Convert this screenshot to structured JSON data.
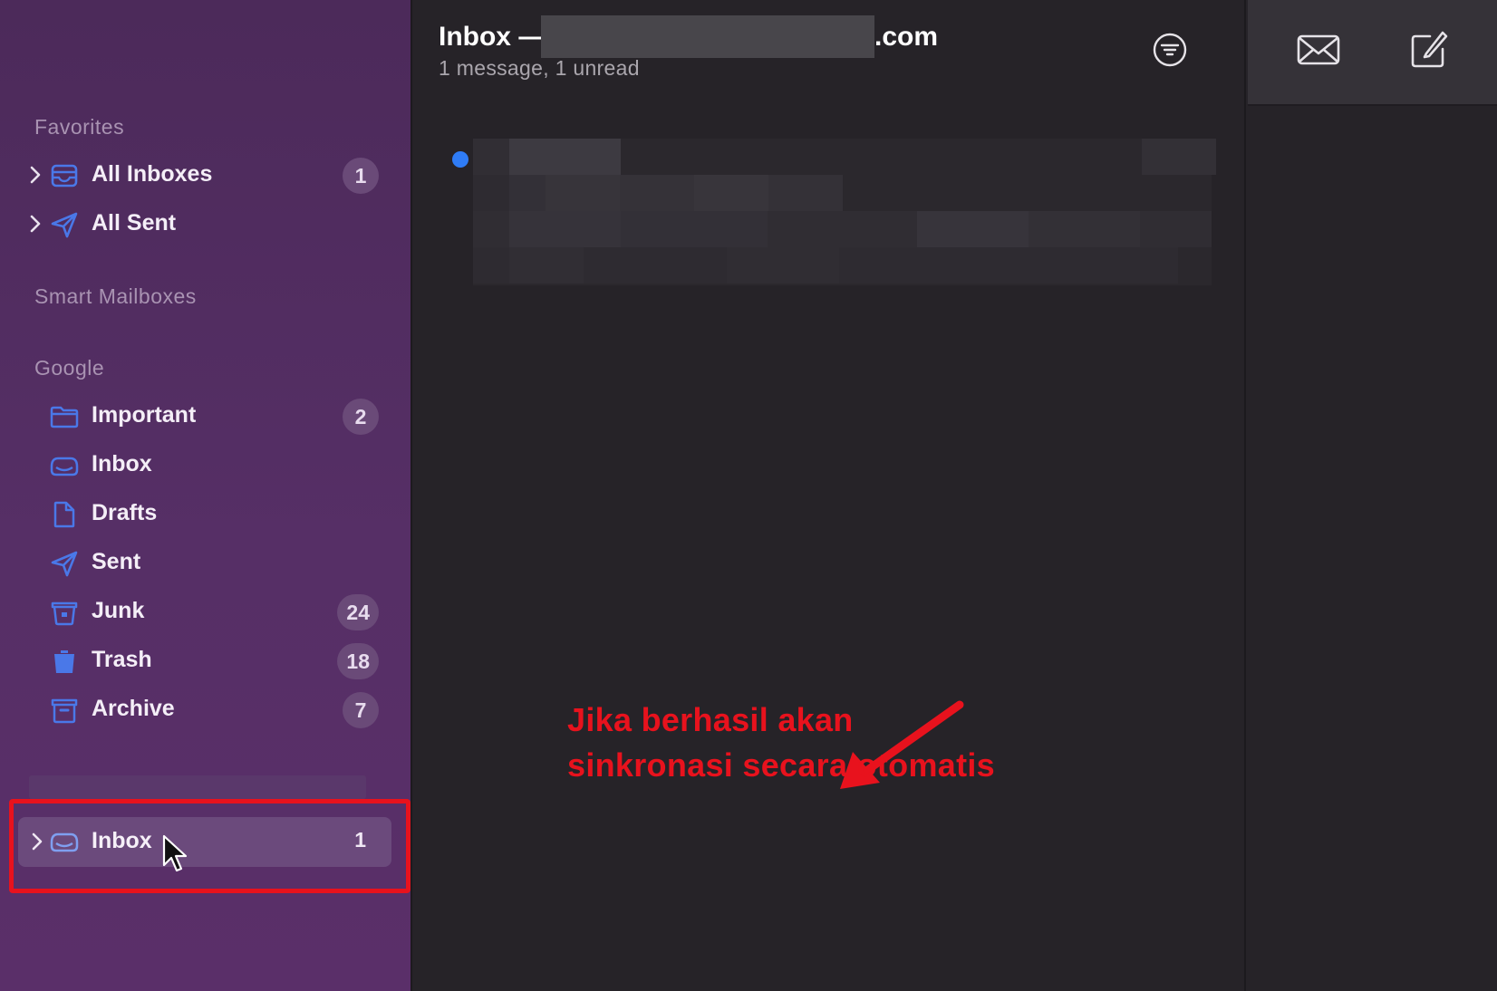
{
  "sidebar": {
    "favorites_header": "Favorites",
    "favorites": [
      {
        "label": "All Inboxes",
        "badge": "1",
        "icon": "tray-icon",
        "expandable": true
      },
      {
        "label": "All Sent",
        "badge": "",
        "icon": "paper-plane-icon",
        "expandable": true
      }
    ],
    "smart_header": "Smart Mailboxes",
    "google_header": "Google",
    "google": [
      {
        "label": "Important",
        "badge": "2",
        "icon": "folder-icon"
      },
      {
        "label": "Inbox",
        "badge": "",
        "icon": "tray-icon"
      },
      {
        "label": "Drafts",
        "badge": "",
        "icon": "document-icon"
      },
      {
        "label": "Sent",
        "badge": "",
        "icon": "paper-plane-icon"
      },
      {
        "label": "Junk",
        "badge": "24",
        "icon": "junk-bin-icon"
      },
      {
        "label": "Trash",
        "badge": "18",
        "icon": "trash-icon"
      },
      {
        "label": "Archive",
        "badge": "7",
        "icon": "archive-box-icon"
      }
    ],
    "account": {
      "label": "Inbox",
      "badge": "1",
      "icon": "tray-icon"
    }
  },
  "list": {
    "title_prefix": "Inbox —",
    "title_suffix": ".com",
    "subtitle": "1 message, 1 unread",
    "filter_icon": "filter-icon"
  },
  "annotation": {
    "line1": "Jika berhasil akan",
    "line2": "sinkronasi secara otomatis",
    "color": "#e8121d"
  },
  "toolbar": {
    "mail_icon": "envelope-icon",
    "compose_icon": "compose-icon"
  },
  "colors": {
    "sidebar_bg": "#562f66",
    "icon_blue": "#4a78e8",
    "unread_dot": "#2f7cf6",
    "highlight": "#e8121d"
  }
}
